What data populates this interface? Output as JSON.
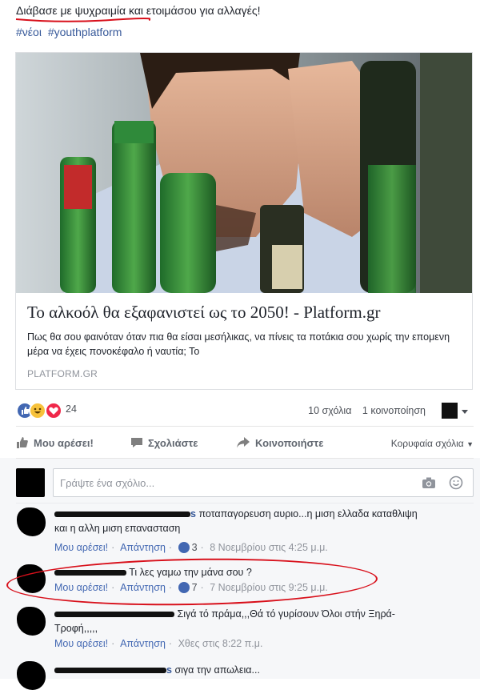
{
  "post": {
    "text": "Διάβασε με ψυχραιμία και ετοιμάσου για αλλαγές!",
    "hashtags": [
      "#νέοι",
      "#youthplatform"
    ]
  },
  "link_card": {
    "title": "Το αλκοόλ θα εξαφανιστεί ως το 2050! - Platform.gr",
    "description": "Πως θα σου φαινόταν όταν πια θα είσαι μεσήλικας, να πίνεις τα ποτάκια σου χωρίς την επομενη μέρα να έχεις πονοκέφαλο ή ναυτία; Το",
    "domain": "PLATFORM.GR"
  },
  "stats": {
    "reaction_count": "24",
    "comments": "10 σχόλια",
    "shares": "1 κοινοποίηση"
  },
  "actions": {
    "like": "Μου αρέσει!",
    "comment": "Σχολιάστε",
    "share": "Κοινοποιήστε",
    "top_comments": "Κορυφαία σχόλια"
  },
  "comment_input": {
    "placeholder": "Γράψτε ένα σχόλιο..."
  },
  "comments": [
    {
      "name_tail": "s",
      "text_line1": "ποταπαγορευση αυριο...η μιση ελλαδα καταθλιψη",
      "text_line2": "και η αλλη μιση επανασταση",
      "like": "Μου αρέσει!",
      "reply": "Απάντηση",
      "likes": "3",
      "time": "8 Νοεμβρίου στις 4:25 μ.μ."
    },
    {
      "name_tail": "",
      "text_line1": "Τι λες γαμω την μάνα σου ?",
      "text_line2": "",
      "like": "Μου αρέσει!",
      "reply": "Απάντηση",
      "likes": "7",
      "time": "7 Νοεμβρίου στις 9:25 μ.μ."
    },
    {
      "name_tail": "",
      "text_line1": "Σιγά τό πράμα,,,Θά τό γυρίσουν Όλοι στήν Ξηρά-",
      "text_line2": "Τροφή,,,,,",
      "like": "Μου αρέσει!",
      "reply": "Απάντηση",
      "likes": "",
      "time": "Χθες στις 8:22 π.μ."
    },
    {
      "name_tail": "s",
      "text_line1": "σιγα την απωλεια...",
      "text_line2": "",
      "like": "",
      "reply": "",
      "likes": "",
      "time": ""
    }
  ],
  "colors": {
    "link": "#365899",
    "like_blue": "#4267b2",
    "annotation_red": "#d8101b",
    "muted": "#90949c"
  }
}
